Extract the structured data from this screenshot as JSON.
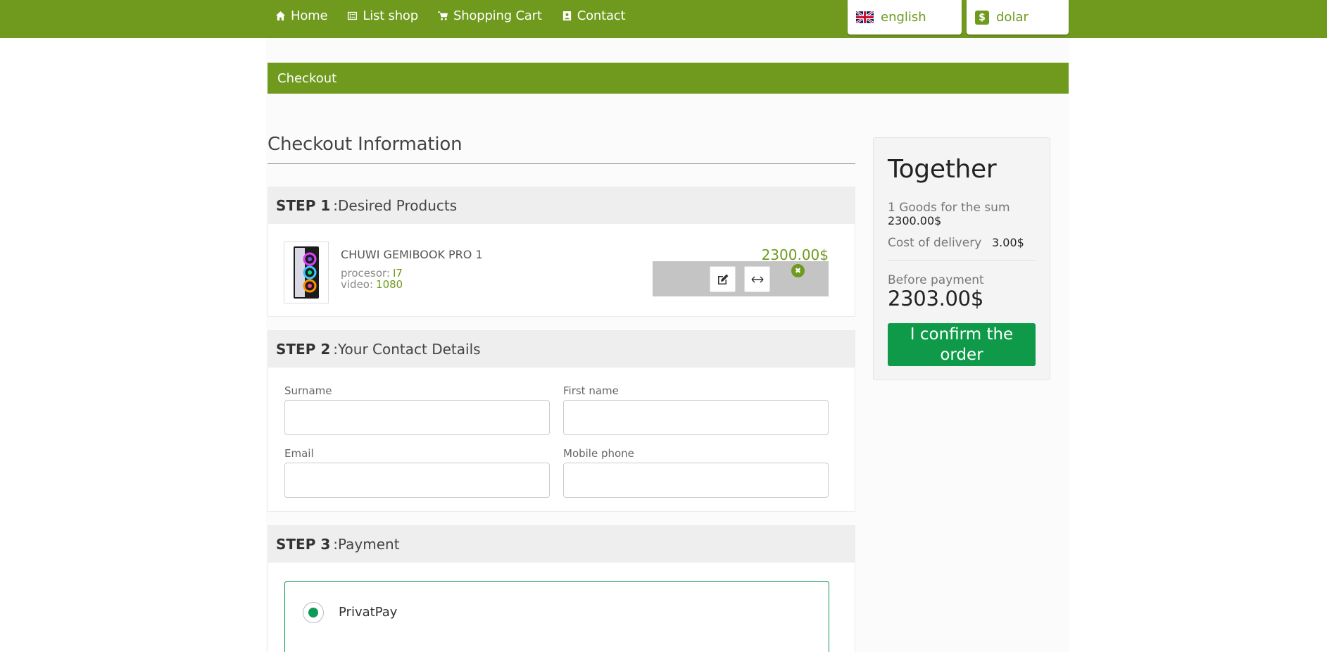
{
  "nav": {
    "items": [
      {
        "label": "Home",
        "icon": "home-icon"
      },
      {
        "label": "List shop",
        "icon": "list-icon"
      },
      {
        "label": "Shopping Cart",
        "icon": "cart-icon"
      },
      {
        "label": "Contact",
        "icon": "contact-card-icon"
      }
    ],
    "language": {
      "label": "english",
      "icon": "uk-flag-icon"
    },
    "currency": {
      "label": "dolar",
      "icon": "dollar-icon",
      "symbol": "$"
    }
  },
  "page": {
    "title_bar": "Checkout",
    "heading": "Checkout Information"
  },
  "step1": {
    "step_label": "STEP 1",
    "title": ":Desired Products",
    "product": {
      "name": "CHUWI GEMIBOOK PRO 1",
      "attrs": [
        {
          "key": "procesor:",
          "value": "I7"
        },
        {
          "key": "video:",
          "value": "1080"
        }
      ],
      "price": "2300.00$"
    }
  },
  "step2": {
    "step_label": "STEP 2",
    "title": ":Your Contact Details",
    "fields": {
      "surname": {
        "label": "Surname",
        "value": ""
      },
      "first_name": {
        "label": "First name",
        "value": ""
      },
      "email": {
        "label": "Email",
        "value": ""
      },
      "phone": {
        "label": "Mobile phone",
        "value": ""
      }
    }
  },
  "step3": {
    "step_label": "STEP 3",
    "title": ":Payment",
    "options": [
      {
        "label": "PrivatPay",
        "selected": true
      }
    ]
  },
  "summary": {
    "title": "Together",
    "goods_label": "1 Goods for the sum",
    "goods_sum": "2300.00$",
    "delivery_label": "Cost of delivery",
    "delivery_value": "3.00$",
    "before_payment_label": "Before payment",
    "total": "2303.00$",
    "confirm_label": "I confirm the order"
  },
  "colors": {
    "brand_green": "#6f9a1e",
    "confirm_green": "#0e9a48"
  }
}
